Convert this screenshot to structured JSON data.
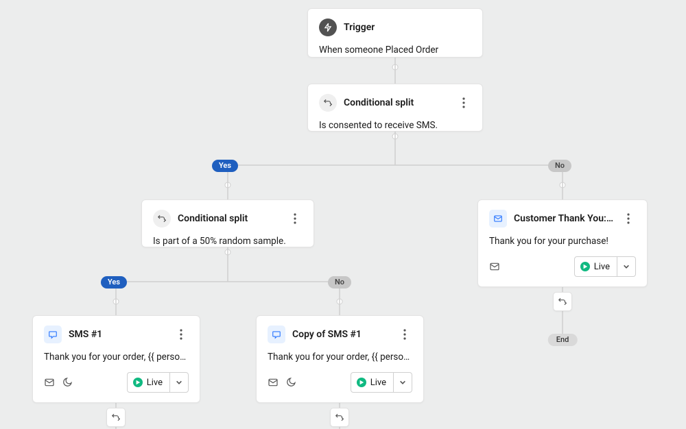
{
  "nodes": {
    "trigger": {
      "title": "Trigger",
      "desc": "When someone Placed Order"
    },
    "split1": {
      "title": "Conditional split",
      "desc": "Is consented to receive SMS."
    },
    "split2": {
      "title": "Conditional split",
      "desc": "Is part of a 50% random sample."
    },
    "sms1": {
      "title": "SMS #1",
      "desc": "Thank you for your order, {{ person|looku...",
      "status": "Live"
    },
    "sms2": {
      "title": "Copy of SMS #1",
      "desc": "Thank you for your order, {{ person|looku...",
      "status": "Live"
    },
    "email": {
      "title": "Customer Thank You: Email...",
      "desc": "Thank you for your purchase!",
      "status": "Live"
    }
  },
  "labels": {
    "yes": "Yes",
    "no": "No",
    "end": "End"
  },
  "colors": {
    "bg": "#eceded",
    "card_bg": "#ffffff",
    "yes_pill": "#1f5fbf",
    "no_pill": "#c7c7c7",
    "status_green": "#10b981",
    "accent_blue": "#2d78ff"
  }
}
